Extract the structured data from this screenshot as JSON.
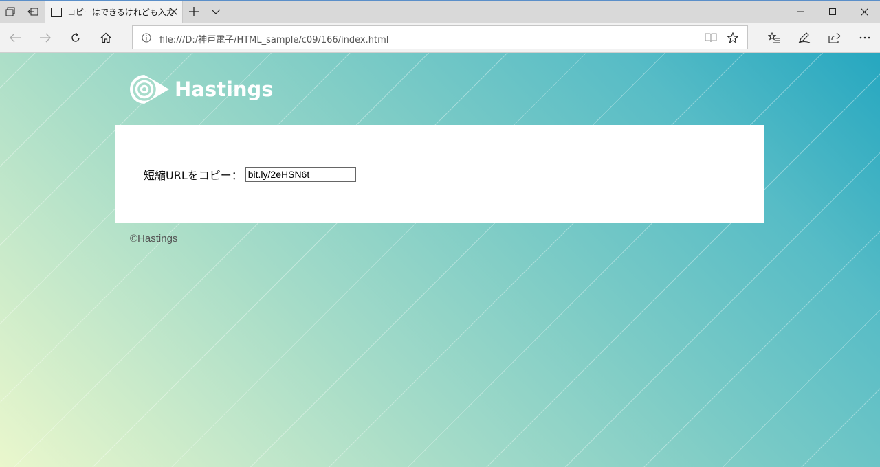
{
  "browser": {
    "tab_title": "コピーはできるけれども入力",
    "address_url": "file:///D:/神戸電子/HTML_sample/c09/166/index.html",
    "icons": [
      "tab-list-icon",
      "set-aside-icon",
      "page-icon",
      "close-tab-icon",
      "new-tab-icon",
      "tab-preview-chevron-icon",
      "minimize-icon",
      "maximize-icon",
      "close-window-icon",
      "back-icon",
      "forward-icon",
      "refresh-icon",
      "home-icon",
      "info-icon",
      "reading-view-icon",
      "favorite-star-icon",
      "favorites-list-icon",
      "pen-icon",
      "share-icon",
      "more-icon"
    ]
  },
  "page": {
    "logo_text": "Hastings",
    "copy_label": "短縮URLをコピー：",
    "copy_value": "bit.ly/2eHSN6t",
    "footer": "©Hastings"
  },
  "colors": {
    "gradient_start": "#eaf7cc",
    "gradient_mid": "#79cac6",
    "gradient_end": "#26a7c0",
    "card": "#ffffff"
  }
}
